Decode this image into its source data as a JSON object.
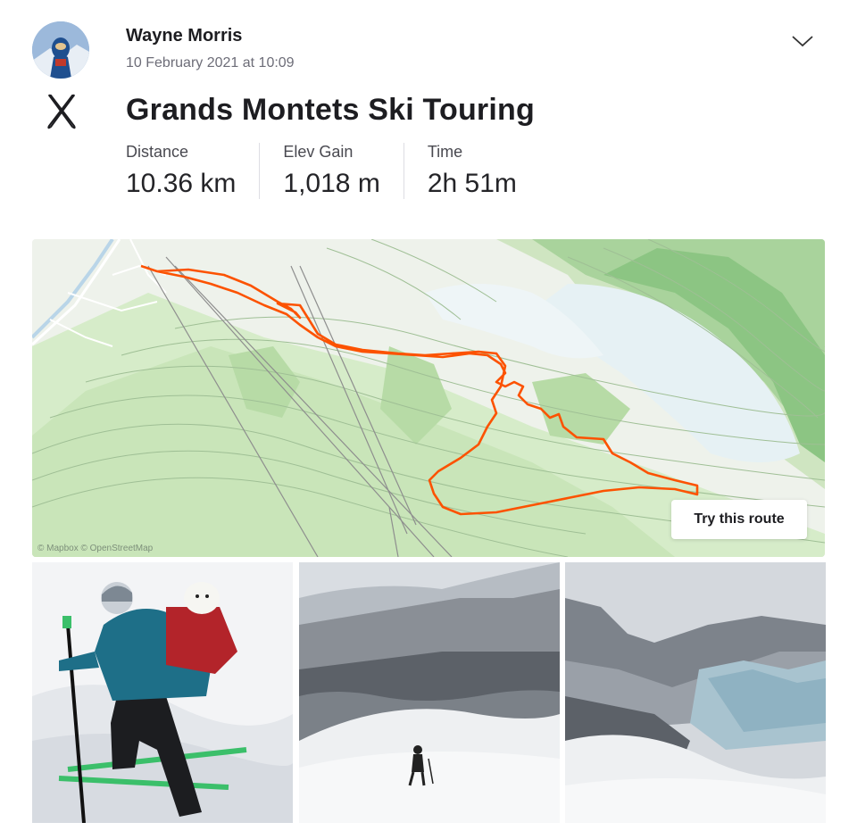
{
  "athlete": {
    "name": "Wayne Morris",
    "timestamp": "10 February 2021 at 10:09"
  },
  "activity": {
    "title": "Grands Montets Ski Touring",
    "sport_icon": "ski-icon",
    "stats": [
      {
        "label": "Distance",
        "value": "10.36 km"
      },
      {
        "label": "Elev Gain",
        "value": "1,018 m"
      },
      {
        "label": "Time",
        "value": "2h 51m"
      }
    ]
  },
  "map": {
    "credit": "© Mapbox © OpenStreetMap",
    "route_color": "#fc5200",
    "try_route_label": "Try this route"
  },
  "photos": [
    {
      "name": "photo-skier-with-dog"
    },
    {
      "name": "photo-glacier-valley-skier"
    },
    {
      "name": "photo-icefall"
    }
  ],
  "icons": {
    "menu": "chevron-down-icon",
    "sport": "ski-icon"
  }
}
